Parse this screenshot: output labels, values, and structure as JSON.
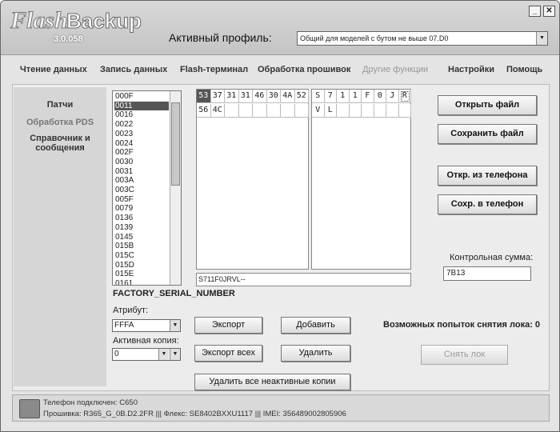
{
  "app": {
    "logo_text": "FlashBackup",
    "version": "3.0.058",
    "minimize_glyph": "_",
    "close_glyph": "✕"
  },
  "profile": {
    "label": "Активный профиль:",
    "value": "Общий для моделей с бутом не выше 07.D0"
  },
  "menu": [
    {
      "label": "Чтение данных",
      "enabled": true
    },
    {
      "label": "Запись данных",
      "enabled": true
    },
    {
      "label": "Flash-терминал",
      "enabled": true
    },
    {
      "label": "Обработка прошивок",
      "enabled": true
    },
    {
      "label": "Другие функции",
      "enabled": false
    },
    {
      "label": "Настройки",
      "enabled": true
    },
    {
      "label": "Помощь",
      "enabled": true
    }
  ],
  "sidebar": [
    {
      "label": "Патчи",
      "muted": false
    },
    {
      "label": "Обработка PDS",
      "muted": true
    },
    {
      "label": "Справочник и сообщения",
      "muted": false
    }
  ],
  "list": {
    "items": [
      "000F",
      "0011",
      "0016",
      "0022",
      "0023",
      "0024",
      "002F",
      "0030",
      "0031",
      "003A",
      "003C",
      "005F",
      "0079",
      "0136",
      "0139",
      "0145",
      "015B",
      "015C",
      "015D",
      "015E",
      "0161"
    ],
    "selected": 1
  },
  "hex": {
    "row1": [
      "53",
      "37",
      "31",
      "31",
      "46",
      "30",
      "4A",
      "52"
    ],
    "row2": [
      "56",
      "4C",
      "",
      "",
      "",
      "",
      "",
      ""
    ],
    "selected_index": 0
  },
  "ascii": {
    "row1": [
      "S",
      "7",
      "1",
      "1",
      "F",
      "0",
      "J",
      "R"
    ],
    "row2": [
      "V",
      "L",
      "",
      "",
      "",
      "",
      "",
      ""
    ],
    "focus_index": 7
  },
  "string_value": "S711F0JRVL--",
  "field_name": "FACTORY_SERIAL_NUMBER",
  "attribute": {
    "label": "Атрибут:",
    "value": "FFFA"
  },
  "active_copy": {
    "label": "Активная копия:",
    "value": "0"
  },
  "buttons": {
    "export": "Экспорт",
    "add": "Добавить",
    "export_all": "Экспорт всех",
    "delete": "Удалить",
    "delete_inactive": "Удалить все неактивные копии",
    "open_file": "Открыть файл",
    "save_file": "Сохранить файл",
    "open_phone": "Откр. из телефона",
    "save_phone": "Сохр. в телефон",
    "unlock": "Снять лок"
  },
  "checksum": {
    "label": "Контрольная сумма:",
    "value": "7B13"
  },
  "unlock_attempts": "Возможных попыток снятия лока: 0",
  "status": {
    "line1": "Телефон подключен: C650",
    "line2": "Прошивка: R365_G_0B.D2.2FR ||| Флекс: SE8402BXXU1117 ||| IMEI: 356489002805906"
  }
}
